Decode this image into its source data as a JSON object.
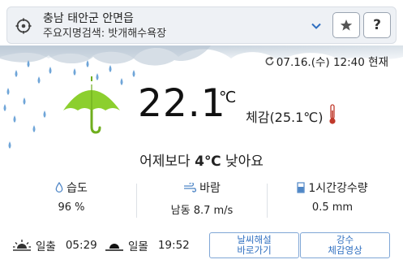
{
  "header": {
    "location": "충남 태안군 안면읍",
    "landmark": "주요지명검색: 밧개해수욕장",
    "icons": {
      "locate": "crosshair-icon",
      "dropdown": "chevron-down-icon",
      "favorite": "star-icon",
      "help": "question-icon"
    },
    "help_label": "?"
  },
  "weather": {
    "updated": "07.16.(수) 12:40 현재",
    "temperature": "22.1",
    "unit": "℃",
    "feels_like": "체감(25.1℃)",
    "comparison_prefix": "어제보다 ",
    "comparison_value": "4℃",
    "comparison_suffix": " 낮아요",
    "condition_icon": "umbrella-rain-icon"
  },
  "stats": {
    "humidity": {
      "label": "습도",
      "value": "96 %"
    },
    "wind": {
      "label": "바람",
      "value": "남동 8.7 m/s"
    },
    "rain": {
      "label": "1시간강수량",
      "value": "0.5 mm"
    }
  },
  "sun": {
    "sunrise_label": "일출",
    "sunrise_time": "05:29",
    "sunset_label": "일몰",
    "sunset_time": "19:52"
  },
  "buttons": {
    "commentary_line1": "날씨해설",
    "commentary_line2": "바로가기",
    "rain_video_line1": "강수",
    "rain_video_line2": "체감영상"
  },
  "colors": {
    "accent": "#2f6fc0",
    "umbrella": "#8ccf2e",
    "header_bg": "#eef1f5",
    "rain": "#6fa5d8"
  }
}
